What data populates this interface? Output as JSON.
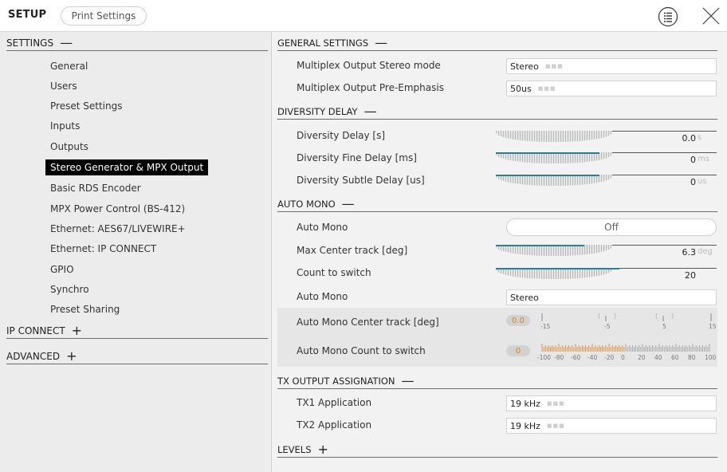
{
  "header": {
    "title": "SETUP",
    "print_label": "Print Settings"
  },
  "sidebar": {
    "settings_label": "SETTINGS",
    "settings_sym": "—",
    "items": [
      {
        "label": "General"
      },
      {
        "label": "Users"
      },
      {
        "label": "Preset Settings"
      },
      {
        "label": "Inputs"
      },
      {
        "label": "Outputs"
      },
      {
        "label": "Stereo Generator & MPX Output"
      },
      {
        "label": "Basic RDS Encoder"
      },
      {
        "label": "MPX Power Control (BS-412)"
      },
      {
        "label": "Ethernet: AES67/LIVEWIRE+"
      },
      {
        "label": "Ethernet: IP CONNECT"
      },
      {
        "label": "GPIO"
      },
      {
        "label": "Synchro"
      },
      {
        "label": "Preset Sharing"
      }
    ],
    "ip_connect_label": "IP CONNECT",
    "advanced_label": "ADVANCED",
    "plus_sym": "+"
  },
  "main": {
    "general": {
      "title": "GENERAL SETTINGS",
      "sym": "—",
      "rows": [
        {
          "label": "Multiplex Output Stereo mode",
          "value": "Stereo"
        },
        {
          "label": "Multiplex Output Pre-Emphasis",
          "value": "50us"
        }
      ]
    },
    "diversity": {
      "title": "DIVERSITY DELAY",
      "sym": "—",
      "rows": [
        {
          "label": "Diversity Delay [s]",
          "value": "0.0",
          "unit": "s",
          "fill": 0
        },
        {
          "label": "Diversity Fine Delay [ms]",
          "value": "0",
          "unit": "ms",
          "fill": 0.47
        },
        {
          "label": "Diversity Subtle Delay [us]",
          "value": "0",
          "unit": "us",
          "fill": 0.47
        }
      ]
    },
    "auto_mono": {
      "title": "AUTO MONO",
      "sym": "—",
      "auto_mono_label": "Auto Mono",
      "auto_mono_toggle": "Off",
      "max_center_label": "Max Center track [deg]",
      "max_center_value": "6.3",
      "max_center_unit": "deg",
      "max_center_fill": 0.4,
      "count_label": "Count to switch",
      "count_value": "20",
      "count_fill": 0.56,
      "auto_mono2_label": "Auto Mono",
      "auto_mono2_value": "Stereo",
      "center_meter_label": "Auto Mono Center track [deg]",
      "center_meter_value": "0.0",
      "center_scale": [
        "-15",
        "-5",
        "5",
        "15"
      ],
      "count_meter_label": "Auto Mono Count to switch",
      "count_meter_value": "0",
      "count_scale": [
        "-100",
        "-80",
        "-60",
        "-40",
        "-20",
        "0",
        "20",
        "40",
        "60",
        "80",
        "100"
      ]
    },
    "tx": {
      "title": "TX OUTPUT ASSIGNATION",
      "sym": "—",
      "rows": [
        {
          "label": "TX1 Application",
          "value": "19 kHz"
        },
        {
          "label": "TX2 Application",
          "value": "19 kHz"
        }
      ]
    },
    "levels": {
      "title": "LEVELS",
      "sym": "+"
    }
  },
  "colors": {
    "accent_bar": "#2a7f92",
    "meter_orange": "#e07f22"
  }
}
